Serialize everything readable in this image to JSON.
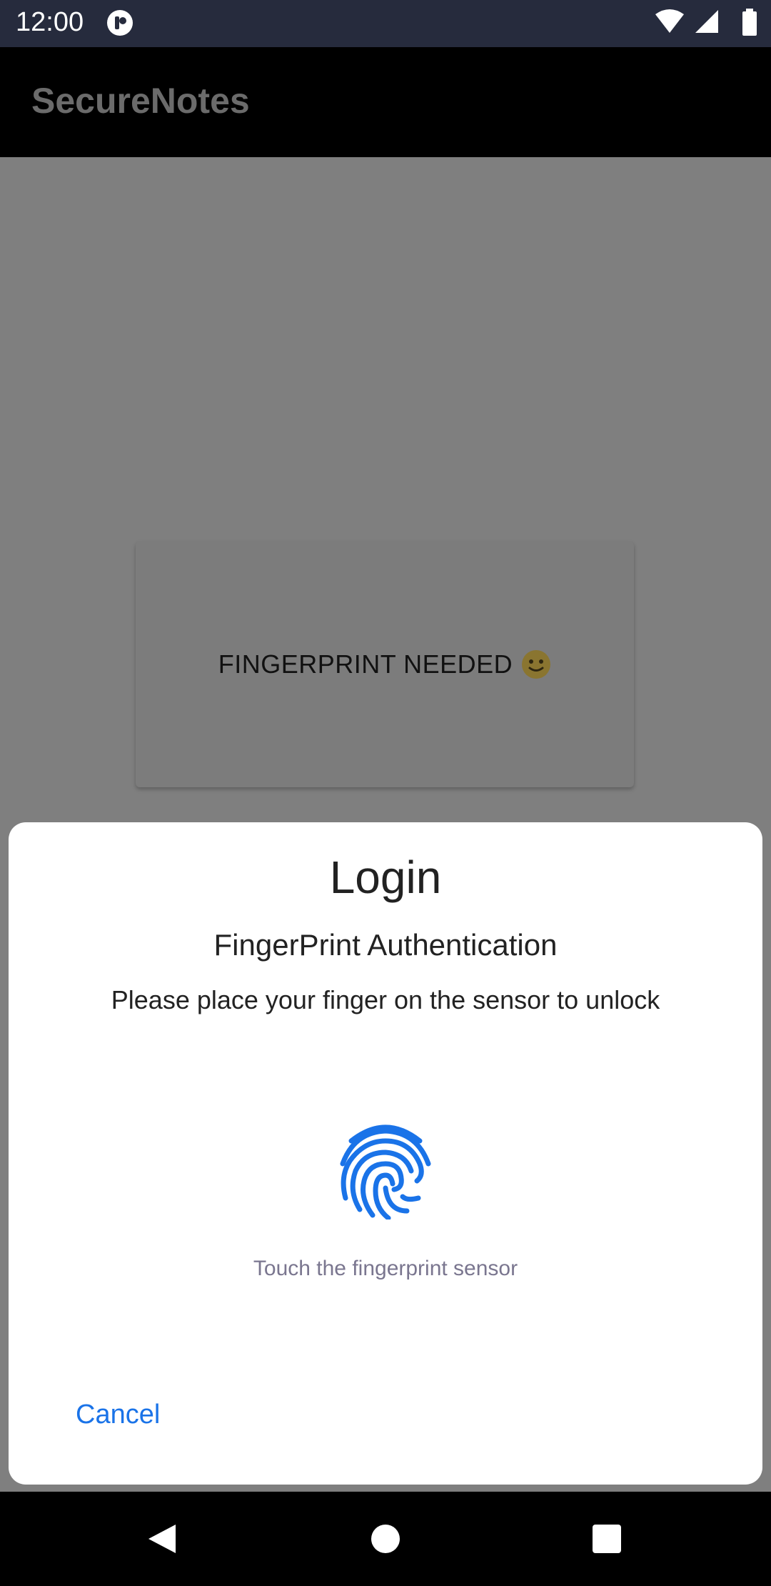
{
  "status_bar": {
    "time": "12:00",
    "icons": [
      "notification-icon",
      "wifi-icon",
      "signal-icon",
      "battery-icon"
    ]
  },
  "app_bar": {
    "title": "SecureNotes"
  },
  "content": {
    "card_text": "FINGERPRINT NEEDED",
    "card_emoji": "slightly-smiling-face"
  },
  "dialog": {
    "title": "Login",
    "subtitle": "FingerPrint Authentication",
    "description": "Please place your finger on the sensor to unlock",
    "icon": "fingerprint-icon",
    "hint": "Touch the fingerprint sensor",
    "cancel_label": "Cancel"
  },
  "nav_bar": {
    "icons": [
      "back-icon",
      "home-icon",
      "recents-icon"
    ]
  },
  "colors": {
    "status_bar": "#262b3d",
    "accent": "#1a73e8",
    "hint": "#7a768f",
    "scrim": "#7f7f7f"
  }
}
